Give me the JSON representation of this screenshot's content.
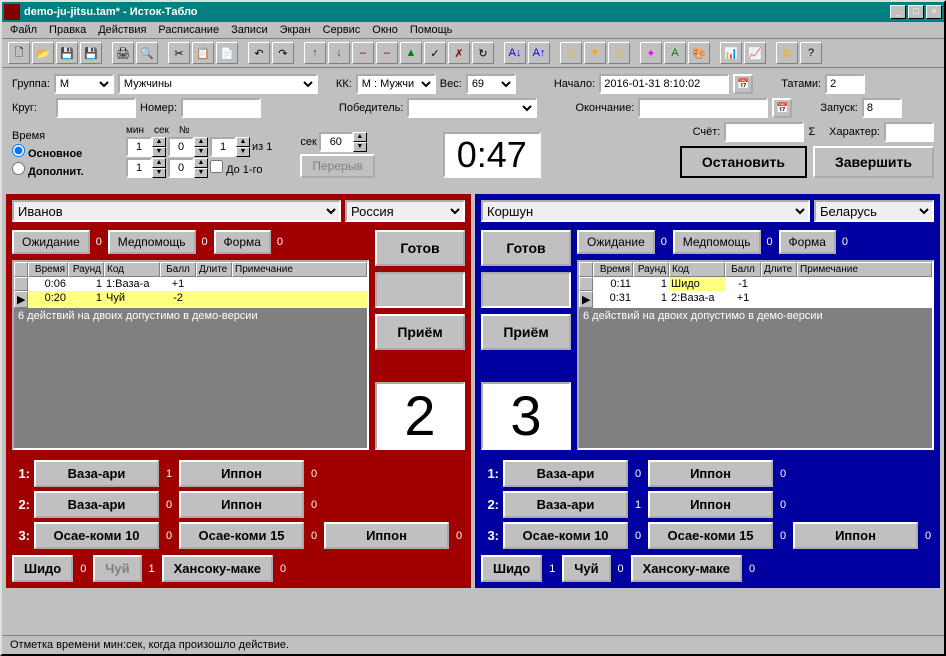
{
  "window": {
    "title": "demo-ju-jitsu.tam* - Исток-Табло"
  },
  "menus": [
    "Файл",
    "Правка",
    "Действия",
    "Расписание",
    "Записи",
    "Экран",
    "Сервис",
    "Окно",
    "Помощь"
  ],
  "form": {
    "group_label": "Группа:",
    "group_code": "M",
    "group_name": "Мужчины",
    "kk_label": "КК:",
    "kk_value": "М : Мужчи",
    "weight_label": "Вес:",
    "weight_value": "69",
    "start_label": "Начало:",
    "start_value": "2016-01-31 8:10:02",
    "tatami_label": "Татами:",
    "tatami_value": "2",
    "round_label": "Круг:",
    "round_value": "",
    "number_label": "Номер:",
    "number_value": "",
    "winner_label": "Победитель:",
    "winner_value": "",
    "end_label": "Окончание:",
    "end_value": "",
    "launch_label": "Запуск:",
    "launch_value": "8",
    "time_label": "Время",
    "min_label": "мин",
    "sec_label": "сек",
    "round_no_label": "№",
    "min_value": "1",
    "sec_value": "0",
    "round_no_value": "1",
    "of_label": "из 1",
    "sec2_label": "сек",
    "sec2_value": "60",
    "main_time_label": "Основное",
    "extra_time_label": "Дополнит.",
    "extra_min": "1",
    "extra_sec": "0",
    "until1_label": "До 1-го",
    "break_label": "Перерыв",
    "score_label": "Счёт:",
    "score_value": "",
    "sigma_label": "Σ",
    "character_label": "Характер:",
    "character_value": ""
  },
  "timer": "0:47",
  "stop_btn": "Остановить",
  "finish_btn": "Завершить",
  "ready_btn": "Готов",
  "technique_btn": "Приём",
  "waiting_btn": "Ожидание",
  "medhelp_btn": "Медпомощь",
  "form_btn": "Форма",
  "red": {
    "name": "Иванов",
    "country": "Россия",
    "waiting": "0",
    "medhelp": "0",
    "form": "0",
    "grid_headers": [
      "",
      "Время",
      "Раунд",
      "Код",
      "Балл",
      "Длите",
      "Примечание"
    ],
    "rows": [
      {
        "mark": "",
        "time": "0:06",
        "round": "1",
        "code": "1:Ваза-а",
        "score": "+1",
        "hl": false
      },
      {
        "mark": "▶",
        "time": "0:20",
        "round": "1",
        "code": "Чуй",
        "score": "-2",
        "hl": true
      }
    ],
    "demo_note": "6 действий на двоих допустимо в демо-версии",
    "score": "2",
    "r1_a": "Ваза-ари",
    "r1_b": "Иппон",
    "r2_a": "Ваза-ари",
    "r2_b": "Иппон",
    "r3_a": "Осае-коми 10",
    "r3_b": "Осае-коми 15",
    "r3_c": "Иппон",
    "shido": "Шидо",
    "chui": "Чуй",
    "hansoku": "Хансоку-маке",
    "c1a": "1",
    "c1b": "0",
    "c2a": "0",
    "c2b": "0",
    "c3a": "0",
    "c3b": "0",
    "c3c": "0",
    "shido_cnt": "0",
    "chui_cnt": "1",
    "hansoku_cnt": "0"
  },
  "blue": {
    "name": "Коршун",
    "country": "Беларусь",
    "waiting": "0",
    "medhelp": "0",
    "form": "0",
    "grid_headers": [
      "",
      "Время",
      "Раунд",
      "Код",
      "Балл",
      "Длите",
      "Примечание"
    ],
    "rows": [
      {
        "mark": "",
        "time": "0:11",
        "round": "1",
        "code": "Шидо",
        "score": "-1",
        "hl": true
      },
      {
        "mark": "▶",
        "time": "0:31",
        "round": "1",
        "code": "2:Ваза-а",
        "score": "+1",
        "hl": false
      }
    ],
    "demo_note": "6 действий на двоих допустимо в демо-версии",
    "score": "3",
    "r1_a": "Ваза-ари",
    "r1_b": "Иппон",
    "r2_a": "Ваза-ари",
    "r2_b": "Иппон",
    "r3_a": "Осае-коми 10",
    "r3_b": "Осае-коми 15",
    "r3_c": "Иппон",
    "shido": "Шидо",
    "chui": "Чуй",
    "hansoku": "Хансоку-маке",
    "c1a": "0",
    "c1b": "0",
    "c2a": "1",
    "c2b": "0",
    "c3a": "0",
    "c3b": "0",
    "c3c": "0",
    "shido_cnt": "1",
    "chui_cnt": "0",
    "hansoku_cnt": "0"
  },
  "labels": {
    "r1": "1:",
    "r2": "2:",
    "r3": "3:"
  },
  "status": "Отметка времени мин:сек, когда произошло действие."
}
